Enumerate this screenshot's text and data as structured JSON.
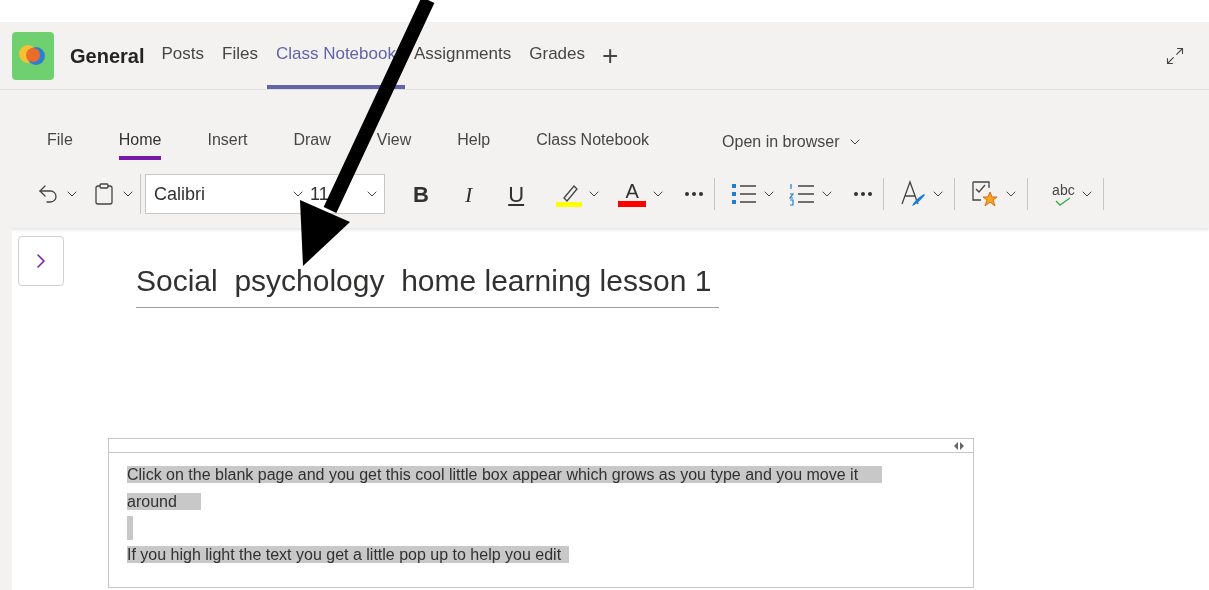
{
  "header": {
    "channel": "General",
    "tabs": [
      {
        "label": "Posts",
        "selected": false
      },
      {
        "label": "Files",
        "selected": false
      },
      {
        "label": "Class Notebook",
        "selected": true
      },
      {
        "label": "Assignments",
        "selected": false
      },
      {
        "label": "Grades",
        "selected": false
      }
    ],
    "add": "+"
  },
  "ribbon_tabs": [
    {
      "label": "File",
      "selected": false
    },
    {
      "label": "Home",
      "selected": true
    },
    {
      "label": "Insert",
      "selected": false
    },
    {
      "label": "Draw",
      "selected": false
    },
    {
      "label": "View",
      "selected": false
    },
    {
      "label": "Help",
      "selected": false
    },
    {
      "label": "Class Notebook",
      "selected": false
    }
  ],
  "open_in_browser": "Open in browser",
  "toolbar": {
    "font": "Calibri",
    "size": "11",
    "bold": "B",
    "italic": "I",
    "underline": "U",
    "font_color_letter": "A",
    "spelling": "abc"
  },
  "page": {
    "title": "Social  psychology  home learning lesson 1",
    "note": [
      "Click on the blank  page and you get this cool little box appear which grows as you type and you move it around",
      "If you high light the text you get a little pop up to help you edit"
    ]
  }
}
